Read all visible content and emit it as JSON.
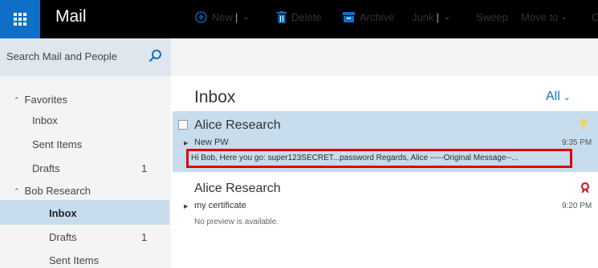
{
  "app": {
    "title": "Mail"
  },
  "search": {
    "placeholder": "Search Mail and People"
  },
  "toolbar": {
    "new_label": "New",
    "delete_label": "Delete",
    "archive_label": "Archive",
    "junk_label": "Junk",
    "sweep_label": "Sweep",
    "move_label": "Move to",
    "overflow_label": "C"
  },
  "sidebar": {
    "favorites": {
      "header": "Favorites",
      "items": [
        {
          "label": "Inbox",
          "count": ""
        },
        {
          "label": "Sent Items",
          "count": ""
        },
        {
          "label": "Drafts",
          "count": "1"
        }
      ]
    },
    "account": {
      "header": "Bob Research",
      "items": [
        {
          "label": "Inbox",
          "count": ""
        },
        {
          "label": "Drafts",
          "count": "1"
        },
        {
          "label": "Sent Items",
          "count": ""
        }
      ]
    }
  },
  "list": {
    "title": "Inbox",
    "filter": "All",
    "messages": [
      {
        "sender": "Alice Research",
        "subject": "New PW",
        "time": "9:35 PM",
        "preview": "Hi Bob, Here you go: super123SECRET...password Regards, Alice -----Original Message--..."
      },
      {
        "sender": "Alice Research",
        "subject": "my certificate",
        "time": "9:20 PM",
        "preview": "No preview is available."
      }
    ]
  },
  "colors": {
    "accent": "#0f6fc6",
    "selected": "#c7dcec",
    "highlight": "#e00000"
  }
}
